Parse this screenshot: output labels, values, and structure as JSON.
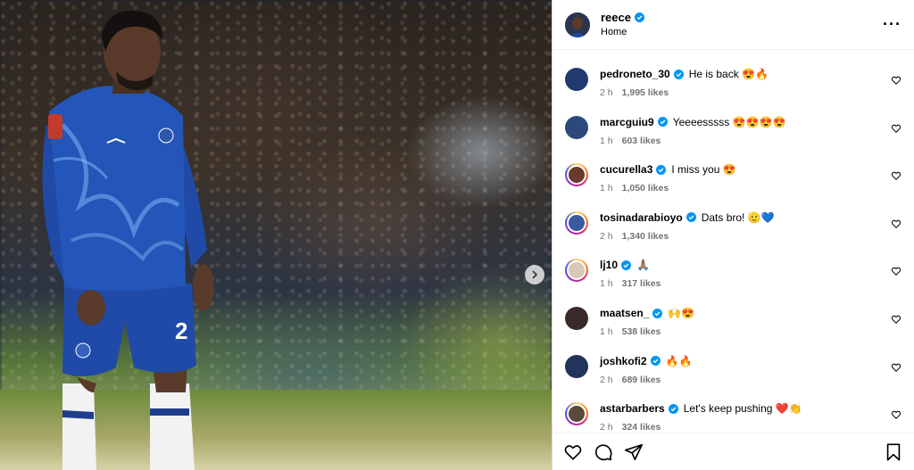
{
  "post": {
    "username": "reece",
    "subtitle": "Home",
    "more_label": "···"
  },
  "comments": [
    {
      "user": "pedroneto_30",
      "text": "He is back 😍🔥",
      "time": "2 h",
      "likes": "1,995 likes",
      "avatar": "#1f3a6e",
      "ring": false
    },
    {
      "user": "marcguiu9",
      "text": "Yeeeesssss 😍😍😍😍",
      "time": "1 h",
      "likes": "603 likes",
      "avatar": "#2b4a7a",
      "ring": false
    },
    {
      "user": "cucurella3",
      "text": "I miss you 😍",
      "time": "1 h",
      "likes": "1,050 likes",
      "avatar": "#6a3a2a",
      "ring": true
    },
    {
      "user": "tosinadarabioyo",
      "text": "Dats bro! 🫡💙",
      "time": "2 h",
      "likes": "1,340 likes",
      "avatar": "#3a5aa0",
      "ring": true
    },
    {
      "user": "lj10",
      "text": "🙏🏽",
      "time": "1 h",
      "likes": "317 likes",
      "avatar": "#d8c8b8",
      "ring": true
    },
    {
      "user": "maatsen_",
      "text": "🙌😍",
      "time": "1 h",
      "likes": "538 likes",
      "avatar": "#3a2a2a",
      "ring": false
    },
    {
      "user": "joshkofi2",
      "text": "🔥🔥",
      "time": "2 h",
      "likes": "689 likes",
      "avatar": "#22345a",
      "ring": false
    },
    {
      "user": "astarbarbers",
      "text": "Let's keep pushing ❤️👏",
      "time": "2 h",
      "likes": "324 likes",
      "avatar": "#5a4a3a",
      "ring": true
    }
  ],
  "colors": {
    "verified": "#0095f6",
    "accent_blue": "#1d4fb0"
  },
  "icons": {
    "like": "heart-icon",
    "comment": "comment-icon",
    "share": "share-icon",
    "save": "bookmark-icon",
    "next": "chevron-right-icon"
  }
}
